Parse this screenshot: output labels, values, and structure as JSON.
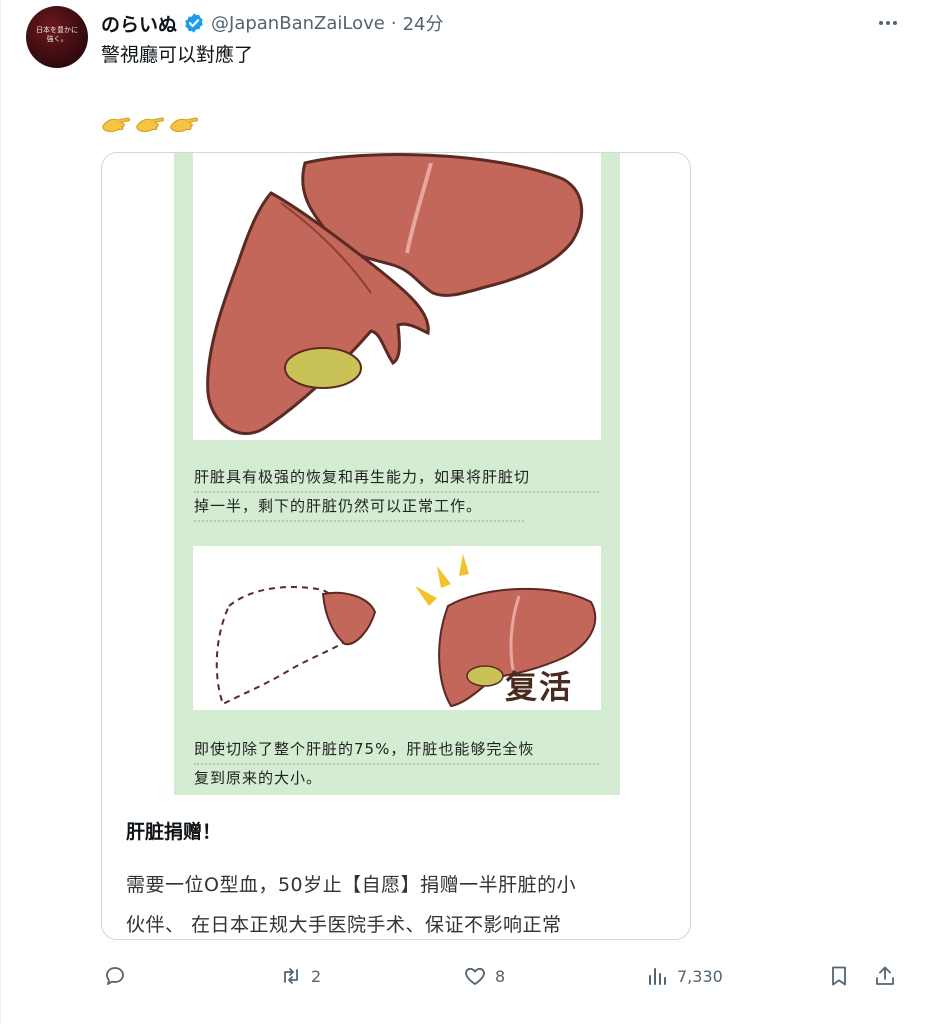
{
  "author": {
    "display_name": "のらいぬ",
    "handle": "@JapanBanZaiLove",
    "separator": "·",
    "time": "24分",
    "avatar_text": "日本を豊かに\n強く。"
  },
  "tweet": {
    "text": "警視廳可以對應了",
    "emoji": [
      "hand-pointing-right-icon",
      "hand-pointing-right-icon",
      "hand-pointing-right-icon"
    ]
  },
  "card": {
    "image_caption_1": "肝脏具有极强的恢复和再生能力，如果将肝脏切\n掉一半，剩下的肝脏仍然可以正常工作。",
    "image_caption_2": "即使切除了整个肝脏的75%，肝脏也能够完全恢\n复到原来的大小。",
    "image_label": "复活",
    "title": "肝脏捐赠！",
    "description": "需要一位O型血，50岁止【自愿】捐赠一半肝脏的小\n伙伴、 在日本正规大手医院手术、保证不影响正常"
  },
  "actions": {
    "reply": {
      "icon": "reply-icon",
      "count": ""
    },
    "retweet": {
      "icon": "retweet-icon",
      "count": "2"
    },
    "like": {
      "icon": "heart-icon",
      "count": "8"
    },
    "views": {
      "icon": "views-icon",
      "count": "7,330"
    },
    "bookmark": {
      "icon": "bookmark-icon"
    },
    "share": {
      "icon": "share-icon"
    }
  },
  "colors": {
    "text_primary": "#0f1419",
    "text_secondary": "#536471",
    "verified_blue": "#1d9bf0",
    "card_border": "#cfd9de",
    "image_green": "#d3ecd2",
    "liver": "#c2675a"
  }
}
